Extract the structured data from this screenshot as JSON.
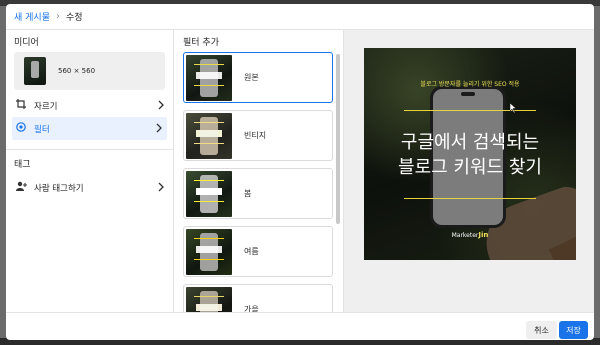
{
  "breadcrumb": {
    "root": "새 게시물",
    "current": "수정"
  },
  "left_panel": {
    "media_title": "미디어",
    "media_size": "560 × 560",
    "items": [
      {
        "label": "자르기",
        "icon": "crop-icon",
        "active": false
      },
      {
        "label": "필터",
        "icon": "filter-icon",
        "active": true
      }
    ],
    "tags_title": "태그",
    "tag_item": {
      "label": "사람 태그하기",
      "icon": "person-add-icon"
    }
  },
  "filter_panel": {
    "title": "필터 추가",
    "filters": [
      {
        "name": "원본",
        "selected": true
      },
      {
        "name": "빈티지",
        "selected": false
      },
      {
        "name": "봄",
        "selected": false
      },
      {
        "name": "여름",
        "selected": false
      },
      {
        "name": "가을",
        "selected": false
      }
    ]
  },
  "preview": {
    "subtitle": "블로그 방문자를 늘리기 위한 SEO 적용",
    "title_line1": "구글에서 검색되는",
    "title_line2": "블로그 키워드 찾기",
    "brand_prefix": "Marketer",
    "brand_name": "Jin"
  },
  "footer": {
    "cancel_label": "취소",
    "save_label": "저장"
  },
  "colors": {
    "accent": "#1a73e8",
    "highlight": "#f1e15b"
  }
}
